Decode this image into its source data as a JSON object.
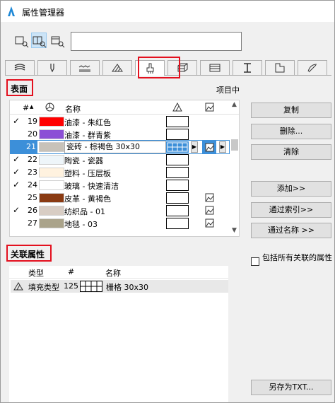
{
  "window": {
    "title": "属性管理器"
  },
  "search": {
    "value": "",
    "placeholder": ""
  },
  "tabs": [
    {
      "name": "composites"
    },
    {
      "name": "pens"
    },
    {
      "name": "line-types"
    },
    {
      "name": "fill-types"
    },
    {
      "name": "surfaces",
      "selected": true
    },
    {
      "name": "building-materials"
    },
    {
      "name": "zones"
    },
    {
      "name": "profiles"
    },
    {
      "name": "markups"
    },
    {
      "name": "mep"
    }
  ],
  "surfaces": {
    "title": "表面",
    "status": "项目中",
    "columns": {
      "num": "#",
      "name": "名称"
    },
    "rows": [
      {
        "check": "✓",
        "num": "19",
        "color": "#ff0000",
        "name": "油漆 - 朱红色",
        "pic": false
      },
      {
        "check": "",
        "num": "20",
        "color": "#8c4fd6",
        "name": "油漆 - 群青紫",
        "pic": false
      },
      {
        "check": "",
        "num": "21",
        "color": "#c8c2b9",
        "name": "瓷砖 - 棕褐色 30x30",
        "pic": true,
        "selected": true
      },
      {
        "check": "✓",
        "num": "22",
        "color": "#eef5f9",
        "name": "陶瓷 - 瓷器",
        "pic": false
      },
      {
        "check": "✓",
        "num": "23",
        "color": "#fff2df",
        "name": "塑料 - 压层板",
        "pic": false
      },
      {
        "check": "✓",
        "num": "24",
        "color": "#ffffff",
        "name": "玻璃 - 快速清洁",
        "pic": false
      },
      {
        "check": "",
        "num": "25",
        "color": "#8a3a12",
        "name": "皮革 - 黄褐色",
        "pic": true
      },
      {
        "check": "✓",
        "num": "26",
        "color": "#d8cdc4",
        "name": "纺织品 - 01",
        "pic": true
      },
      {
        "check": "",
        "num": "27",
        "color": "#aaa38a",
        "name": "地毯 - 03",
        "pic": true
      }
    ]
  },
  "buttons": {
    "copy": "复制",
    "delete": "删除...",
    "clear": "清除",
    "add": "添加>>",
    "by_index": "通过索引>>",
    "by_name": "通过名称 >>"
  },
  "related": {
    "title": "关联属性",
    "columns": {
      "type": "类型",
      "num": "#",
      "name": "名称"
    },
    "rows": [
      {
        "type": "填充类型",
        "num": "125",
        "name": "栅格 30x30"
      }
    ]
  },
  "include_all": {
    "label": "包括所有关联的属性",
    "checked": false
  },
  "save_txt": "另存为TXT..."
}
